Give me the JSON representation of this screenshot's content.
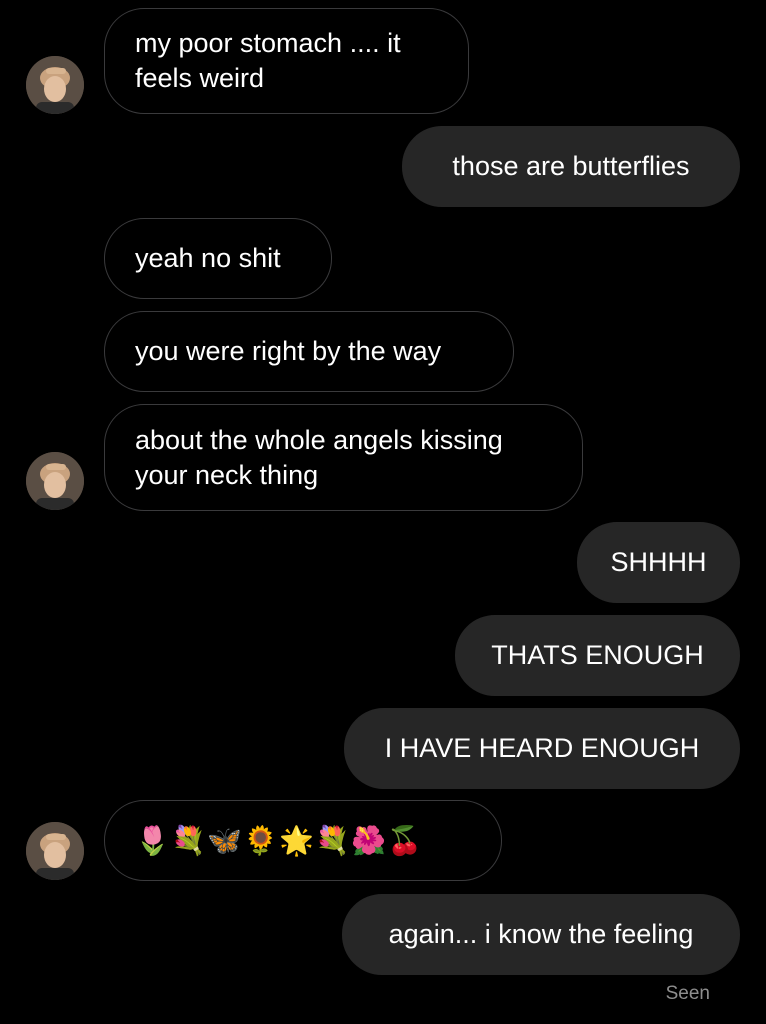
{
  "conversation": {
    "messages": [
      {
        "direction": "incoming",
        "text": "my poor stomach .... it\nfeels weird"
      },
      {
        "direction": "outgoing",
        "text": "those are butterflies"
      },
      {
        "direction": "incoming",
        "text": "yeah no shit"
      },
      {
        "direction": "incoming",
        "text": "you were right by the way"
      },
      {
        "direction": "incoming",
        "text": "about the whole angels kissing\nyour neck thing"
      },
      {
        "direction": "outgoing",
        "text": "SHHHH"
      },
      {
        "direction": "outgoing",
        "text": "THATS ENOUGH"
      },
      {
        "direction": "outgoing",
        "text": "I HAVE HEARD ENOUGH"
      },
      {
        "direction": "incoming",
        "emojis": [
          {
            "name": "tulip",
            "char": "🌷",
            "color": "#e63a5c"
          },
          {
            "name": "bouquet",
            "char": "💐",
            "color": "#f0a8c0"
          },
          {
            "name": "butterfly",
            "char": "🦋",
            "color": "#3a8fe8"
          },
          {
            "name": "sunflower",
            "char": "🌻",
            "color": "#f4c20d"
          },
          {
            "name": "glowing-star",
            "char": "🌟",
            "color": "#fbd43c"
          },
          {
            "name": "bouquet",
            "char": "💐",
            "color": "#f0a8c0"
          },
          {
            "name": "hibiscus",
            "char": "🌺",
            "color": "#e8334a"
          },
          {
            "name": "cherries",
            "char": "🍒",
            "color": "#d6132a"
          }
        ]
      },
      {
        "direction": "outgoing",
        "text": "again... i know the feeling"
      }
    ],
    "status": "Seen"
  },
  "theme": {
    "background": "#000000",
    "outgoing_bubble": "#262626",
    "incoming_border": "#3a3a3c",
    "text": "#ffffff",
    "status_text": "#8e8e8e"
  }
}
